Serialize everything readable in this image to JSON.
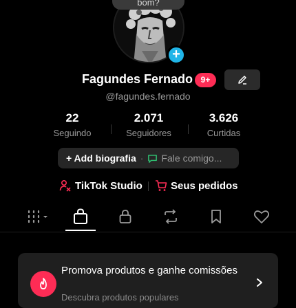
{
  "profile": {
    "bubble_text": "bom?",
    "display_name": "Fagundes Fernado",
    "notif_count": "9+",
    "username": "@fagundes.fernado"
  },
  "stats": [
    {
      "value": "22",
      "label": "Seguindo"
    },
    {
      "value": "2.071",
      "label": "Seguidores"
    },
    {
      "value": "3.626",
      "label": "Curtidas"
    }
  ],
  "bio": {
    "add_label": "+ Add biografia",
    "separator": "·",
    "message_label": "Fale comigo..."
  },
  "links": {
    "studio_label": "TikTok Studio",
    "orders_label": "Seus pedidos"
  },
  "tabs": [
    "videos-grid",
    "shop",
    "private",
    "reposts",
    "saved",
    "liked"
  ],
  "promo": {
    "title": "Promova produtos e ganhe comissões",
    "subtitle": "Descubra produtos populares"
  },
  "colors": {
    "accent": "#fe2c55",
    "plus_badge": "#20b5e8",
    "message_icon": "#2fbf71"
  }
}
